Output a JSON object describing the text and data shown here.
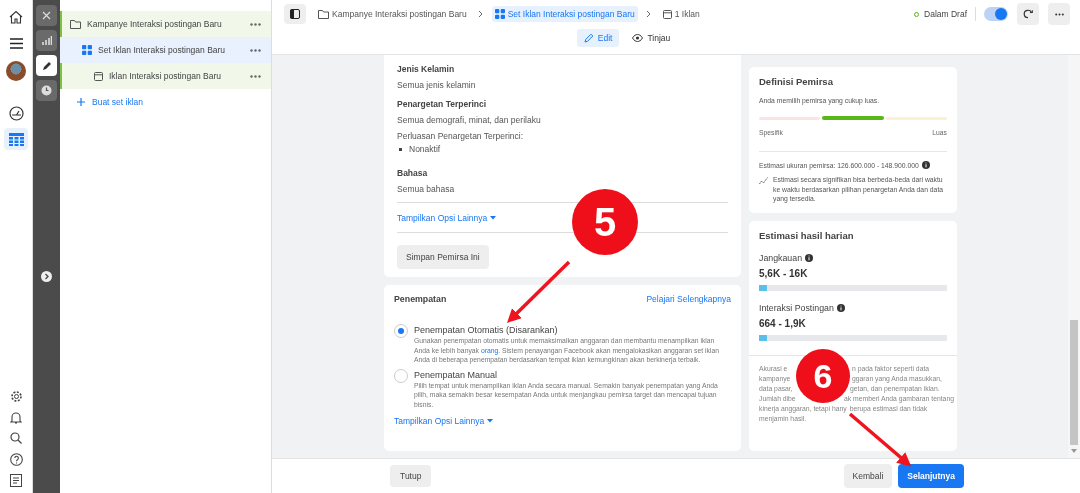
{
  "nav_items": [
    {
      "kind": "home",
      "selected": false
    },
    {
      "kind": "menu",
      "selected": false
    },
    {
      "kind": "avatar",
      "selected": false
    },
    {
      "kind": "gauge",
      "selected": false
    },
    {
      "kind": "grid",
      "selected": true
    }
  ],
  "nav_bottom": [
    {
      "kind": "settings"
    },
    {
      "kind": "bell"
    },
    {
      "kind": "search"
    },
    {
      "kind": "help"
    },
    {
      "kind": "document"
    }
  ],
  "tools": [
    {
      "kind": "close",
      "selected": false
    },
    {
      "kind": "chart",
      "selected": false
    },
    {
      "kind": "edit",
      "selected": true
    },
    {
      "kind": "history",
      "selected": false
    }
  ],
  "tree": [
    {
      "label": "Kampanye Interaksi postingan Baru",
      "kind": "campaign",
      "selected": false,
      "children": [
        {
          "label": "Set Iklan Interaksi postingan Baru",
          "kind": "adset",
          "selected": true,
          "children": [
            {
              "label": "Iklan Interaksi postingan Baru",
              "kind": "ad",
              "selected": false
            }
          ]
        }
      ]
    }
  ],
  "create_link": "Buat set iklan",
  "breadcrumb": [
    {
      "label": "Kampanye Interaksi postingan Baru",
      "kind": "campaign",
      "selected": false
    },
    {
      "label": "Set Iklan Interaksi postingan Baru",
      "kind": "adset",
      "selected": true
    },
    {
      "label": "1 Iklan",
      "kind": "ad",
      "selected": false
    }
  ],
  "status": {
    "label": "Dalam Draf",
    "on": true
  },
  "modes": [
    {
      "label": "Edit",
      "kind": "edit",
      "selected": true
    },
    {
      "label": "Tinjau",
      "kind": "view",
      "selected": false
    }
  ],
  "audience": {
    "sections": [
      {
        "heading": "Jenis Kelamin",
        "lines": [
          "Semua jenis kelamin"
        ]
      },
      {
        "heading": "Penargetan Terperinci",
        "lines": [
          "Semua demografi, minat, dan perilaku"
        ],
        "sublabel": "Perluasan Penargetan Terperinci:",
        "bullets": [
          "Nonaktif"
        ]
      },
      {
        "heading": "Bahasa",
        "lines": [
          "Semua bahasa"
        ]
      }
    ],
    "more_link": "Tampilkan Opsi Lainnya",
    "save_button": "Simpan Pemirsa Ini"
  },
  "placement": {
    "title": "Penempatan",
    "link": "Pelajari Selengkapnya",
    "options": [
      {
        "label": "Penempatan Otomatis (Disarankan)",
        "selected": true,
        "description": "Gunakan penempatan otomatis untuk memaksimalkan anggaran dan membantu menampilkan iklan Anda ke lebih banyak ",
        "link": "orang",
        "after": ". Sistem penayangan Facebook akan mengalokasikan anggaran set iklan Anda di beberapa penempatan berdasarkan tempat iklan kemungkinan akan berkinerja terbaik."
      },
      {
        "label": "Penempatan Manual",
        "selected": false,
        "description": "Pilih tempat untuk menampilkan iklan Anda secara manual. Semakin banyak penempatan yang Anda pilih, maka semakin besar kesempatan Anda untuk menjangkau pemirsa target dan mencapai tujuan bisnis."
      }
    ],
    "more_link": "Tampilkan Opsi Lainnya"
  },
  "definition": {
    "title": "Definisi Pemirsa",
    "text": "Anda memilih pemirsa yang cukup luas.",
    "segments": [
      {
        "color": "#fbe4e4",
        "selected": false
      },
      {
        "color": "#5ab71a",
        "selected": true
      },
      {
        "color": "#fdf1d2",
        "selected": false
      }
    ],
    "low_label": "Spesifik",
    "high_label": "Luas",
    "estimate": "Estimasi ukuran pemirsa: 126.600.000 - 148.900.000",
    "note": "Estimasi secara signifikan bisa berbeda-beda dari waktu ke waktu berdasarkan pilihan penargetan Anda dan data yang tersedia."
  },
  "results": {
    "title": "Estimasi hasil harian",
    "metrics": [
      {
        "label": "Jangkauan",
        "value": "5,6K - 16K",
        "level": 0.04
      },
      {
        "label": "Interaksi Postingan",
        "value": "664 - 1,9K",
        "level": 0.04
      }
    ],
    "disclaimer_lines": [
      {
        "left": "Akurasi e",
        "right": "n pada faktor seperti data"
      },
      {
        "left": "kampanye",
        "right": "ggaran yang Anda masukkan,"
      },
      {
        "left": "data pasar,",
        "right": "getan, dan penempatan iklan."
      },
      {
        "left": "Jumlah dibe",
        "right": "ak memberi Anda gambaran tentang"
      },
      {
        "left": "kinerja anggaran, tetapi hany",
        "right": "berupa estimasi dan tidak"
      },
      {
        "left": "menjamin hasil."
      }
    ]
  },
  "footer": {
    "close": "Tutup",
    "back": "Kembali",
    "next": "Selanjutnya"
  },
  "annotations": [
    {
      "label": "5"
    },
    {
      "label": "6"
    }
  ]
}
